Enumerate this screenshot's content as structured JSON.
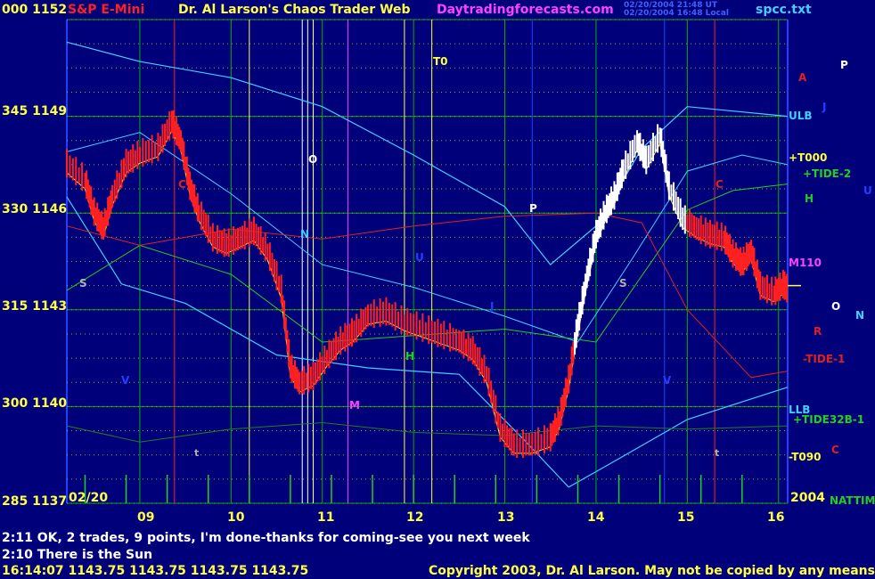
{
  "header": {
    "left_axis_top": "000  1152",
    "title": "S&P E-Mini",
    "site_title": "Dr. Al Larson's Chaos Trader Web",
    "site_url": "Daytradingforecasts.com",
    "timestamp_line1": "02/20/2004 21:48 UT",
    "timestamp_line2": "02/20/2004 16:48 Local",
    "file_name": "spcc.txt"
  },
  "colors": {
    "background": "#00007a",
    "grid": "#00b000",
    "price_up": "#ff2020",
    "price_late": "#ffffff",
    "cyan": "#40d0ff",
    "yellow": "#ffff40",
    "magenta": "#ff40ff",
    "red_line": "#e02020",
    "green_line": "#20d020"
  },
  "chart_data": {
    "type": "line",
    "title": "S&P E-Mini",
    "date_label": "02/20",
    "year_label": "2004",
    "y_tick_labels": [
      "000  1152",
      "345  1149",
      "330  1146",
      "315  1143",
      "300  1140",
      "285  1137"
    ],
    "y_values": [
      1152,
      1149,
      1146,
      1143,
      1140,
      1137
    ],
    "ylim": [
      1137,
      1152
    ],
    "x_tick_labels": [
      "09",
      "10",
      "11",
      "12",
      "13",
      "14",
      "15",
      "16"
    ],
    "xlim": [
      8.2,
      16.1
    ],
    "price_series": {
      "name": "",
      "points": [
        [
          8.2,
          1147.5
        ],
        [
          8.4,
          1147.0
        ],
        [
          8.5,
          1146.0
        ],
        [
          8.6,
          1145.5
        ],
        [
          8.7,
          1146.5
        ],
        [
          8.85,
          1147.5
        ],
        [
          9.0,
          1147.8
        ],
        [
          9.2,
          1148.0
        ],
        [
          9.35,
          1148.8
        ],
        [
          9.45,
          1148.2
        ],
        [
          9.55,
          1146.8
        ],
        [
          9.65,
          1146.0
        ],
        [
          9.8,
          1145.2
        ],
        [
          9.95,
          1145.0
        ],
        [
          10.1,
          1145.2
        ],
        [
          10.25,
          1145.4
        ],
        [
          10.4,
          1144.8
        ],
        [
          10.55,
          1143.6
        ],
        [
          10.65,
          1141.2
        ],
        [
          10.75,
          1140.7
        ],
        [
          10.9,
          1140.9
        ],
        [
          11.05,
          1141.5
        ],
        [
          11.2,
          1142.0
        ],
        [
          11.35,
          1142.3
        ],
        [
          11.5,
          1142.8
        ],
        [
          11.7,
          1142.9
        ],
        [
          11.9,
          1142.6
        ],
        [
          12.1,
          1142.4
        ],
        [
          12.3,
          1142.2
        ],
        [
          12.5,
          1142.0
        ],
        [
          12.65,
          1141.7
        ],
        [
          12.8,
          1141.0
        ],
        [
          12.95,
          1139.3
        ],
        [
          13.1,
          1138.8
        ],
        [
          13.3,
          1138.8
        ],
        [
          13.5,
          1139.0
        ],
        [
          13.6,
          1139.6
        ],
        [
          13.7,
          1140.8
        ],
        [
          13.8,
          1142.5
        ],
        [
          13.9,
          1144.0
        ],
        [
          14.0,
          1145.3
        ],
        [
          14.1,
          1146.0
        ],
        [
          14.2,
          1146.5
        ],
        [
          14.3,
          1147.3
        ],
        [
          14.45,
          1148.2
        ],
        [
          14.55,
          1147.6
        ],
        [
          14.7,
          1148.4
        ],
        [
          14.8,
          1146.8
        ],
        [
          14.95,
          1145.8
        ],
        [
          15.1,
          1145.5
        ],
        [
          15.25,
          1145.3
        ],
        [
          15.4,
          1145.2
        ],
        [
          15.5,
          1144.7
        ],
        [
          15.6,
          1144.4
        ],
        [
          15.7,
          1144.8
        ],
        [
          15.8,
          1143.7
        ],
        [
          15.95,
          1143.5
        ],
        [
          16.05,
          1143.75
        ],
        [
          16.1,
          1143.6
        ]
      ]
    },
    "right_labels": [
      "ULB",
      "+T000",
      "+TIDE-2",
      "H",
      "M110",
      "O",
      "N",
      "R",
      "-TIDE-1",
      "LLB",
      "+TIDE32B-1",
      "-T090",
      "C",
      "NATTIME",
      "P",
      "A",
      "J",
      "U"
    ],
    "chart_letters": [
      "T0",
      "O",
      "C",
      "N",
      "P",
      "U",
      "S",
      "S",
      "J",
      "H",
      "M",
      "V",
      "V",
      "C",
      "t",
      "t"
    ]
  },
  "footer": {
    "comment_1": "2:11 OK, 2 trades, 9 points, I'm done-thanks for coming-see you next week",
    "comment_2": "2:10 There is the Sun",
    "quote_line": "16:14:07  1143.75 1143.75 1143.75 1143.75",
    "copyright": "Copyright 2003, Dr. Al Larson. May not be copied by any means."
  }
}
